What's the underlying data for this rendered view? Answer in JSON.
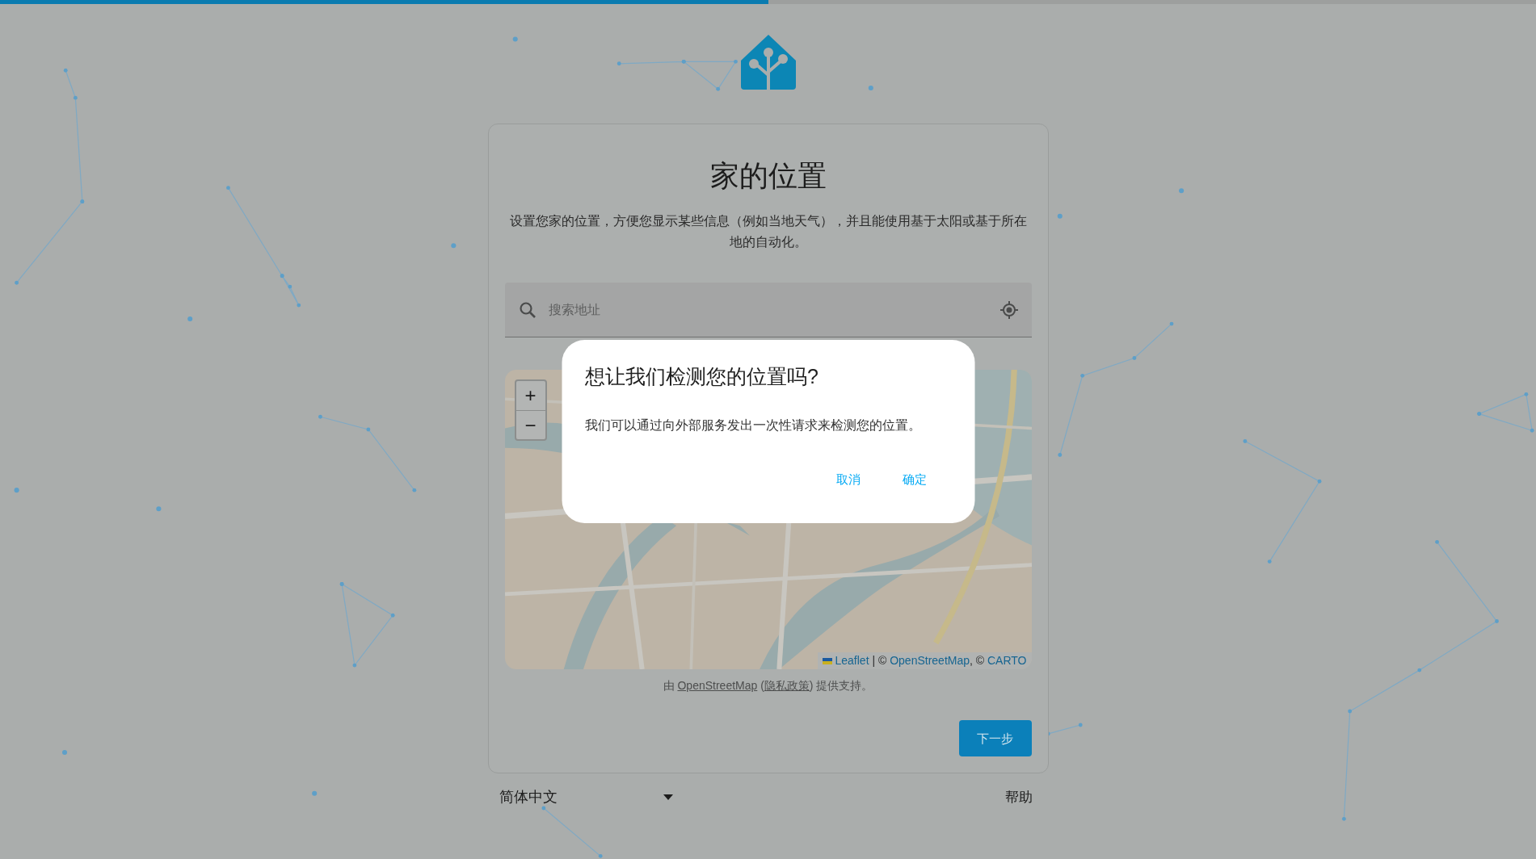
{
  "progress": {
    "level": 0.5
  },
  "title": "家的位置",
  "description": "设置您家的位置，方便您显示某些信息（例如当地天气），并且能使用基于太阳或基于所在地的自动化。",
  "search": {
    "placeholder": "搜索地址"
  },
  "map": {
    "zoom_in": "+",
    "zoom_out": "−",
    "attribution": [
      {
        "kind": "flag-link",
        "text": "Leaflet"
      },
      {
        "kind": "text",
        "text": " | © "
      },
      {
        "kind": "link",
        "text": "OpenStreetMap"
      },
      {
        "kind": "text",
        "text": ", © "
      },
      {
        "kind": "link",
        "text": "CARTO"
      }
    ]
  },
  "powered_by": [
    {
      "kind": "text",
      "text": "由 "
    },
    {
      "kind": "link",
      "text": "OpenStreetMap"
    },
    {
      "kind": "text",
      "text": " ("
    },
    {
      "kind": "link",
      "text": "隐私政策"
    },
    {
      "kind": "text",
      "text": ") 提供支持。"
    }
  ],
  "next_button": "下一步",
  "footer": {
    "language": "简体中文",
    "help": "帮助"
  },
  "dialog": {
    "title": "想让我们检测您的位置吗?",
    "body": "我们可以通过向外部服务发出一次性请求来检测您的位置。",
    "buttons": [
      "取消",
      "确定"
    ]
  }
}
